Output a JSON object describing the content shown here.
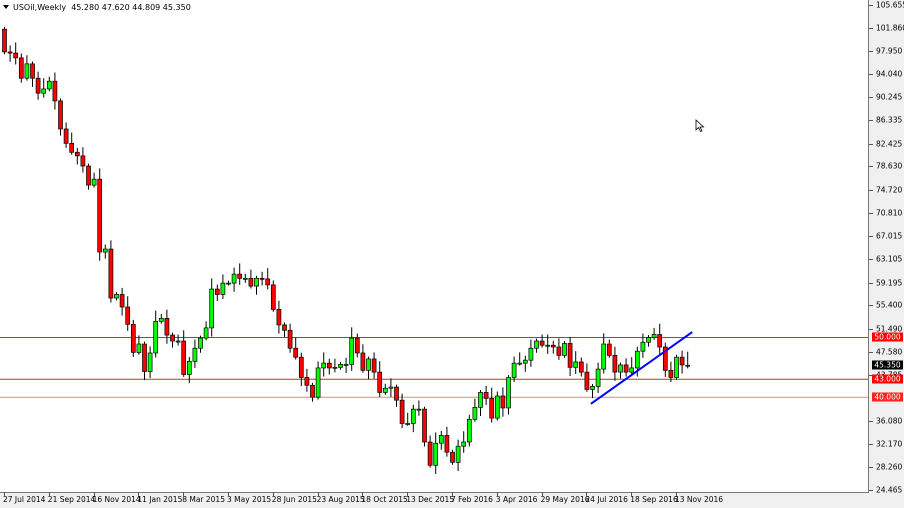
{
  "header": {
    "symbol": "USOil,Weekly",
    "ohlc": "45.280 47.620 44.809 45.350"
  },
  "colors": {
    "bull": "#00ff00",
    "bear": "#ff0000",
    "level_dark": "#b03a2e",
    "level_light": "#f08080",
    "trendline": "#0000ff",
    "current": "#000000"
  },
  "price_axis": {
    "min": 24.465,
    "max": 105.655,
    "ticks": [
      "105.655",
      "101.860",
      "97.950",
      "94.040",
      "90.245",
      "86.335",
      "82.425",
      "78.630",
      "74.720",
      "70.810",
      "67.015",
      "63.105",
      "59.195",
      "55.400",
      "51.490",
      "47.580",
      "43.785",
      "36.080",
      "32.170",
      "28.260",
      "24.465"
    ]
  },
  "levels": [
    {
      "value": 50.0,
      "label": "50.000",
      "style": "dark"
    },
    {
      "value": 43.0,
      "label": "43.000",
      "style": "dark"
    },
    {
      "value": 40.0,
      "label": "40.000",
      "style": "light"
    }
  ],
  "current_price": {
    "value": 45.35,
    "label": "45.350"
  },
  "time_axis": {
    "labels": [
      {
        "text": "27 Jul 2014",
        "week": 0
      },
      {
        "text": "21 Sep 2014",
        "week": 8
      },
      {
        "text": "16 Nov 2014",
        "week": 16
      },
      {
        "text": "11 Jan 2015",
        "week": 24
      },
      {
        "text": "8 Mar 2015",
        "week": 32
      },
      {
        "text": "3 May 2015",
        "week": 40
      },
      {
        "text": "28 Jun 2015",
        "week": 48
      },
      {
        "text": "23 Aug 2015",
        "week": 56
      },
      {
        "text": "18 Oct 2015",
        "week": 64
      },
      {
        "text": "13 Dec 2015",
        "week": 72
      },
      {
        "text": "7 Feb 2016",
        "week": 80
      },
      {
        "text": "3 Apr 2016",
        "week": 88
      },
      {
        "text": "29 May 2016",
        "week": 96
      },
      {
        "text": "24 Jul 2016",
        "week": 104
      },
      {
        "text": "18 Sep 2016",
        "week": 112
      },
      {
        "text": "13 Nov 2016",
        "week": 120
      }
    ]
  },
  "trendline": {
    "from": {
      "week": 104.8,
      "price": 38.9
    },
    "to": {
      "week": 122.9,
      "price": 50.9
    }
  },
  "chart_data": {
    "type": "candlestick",
    "first_open": 101.6,
    "closes": [
      97.8,
      97.6,
      96.8,
      93.4,
      95.8,
      93.4,
      90.9,
      91.6,
      92.9,
      89.6,
      84.9,
      82.5,
      81.0,
      80.4,
      78.7,
      75.5,
      76.5,
      64.3,
      64.8,
      56.6,
      57.2,
      55.1,
      52.2,
      47.5,
      48.9,
      44.3,
      47.4,
      52.7,
      53.2,
      50.4,
      49.4,
      49.4,
      43.8,
      46.0,
      48.2,
      49.9,
      51.6,
      58.1,
      57.2,
      59.1,
      59.1,
      60.6,
      59.9,
      59.9,
      58.6,
      59.9,
      59.8,
      58.8,
      54.7,
      52.1,
      51.2,
      48.2,
      46.7,
      43.3,
      42.0,
      40.0,
      44.9,
      45.7,
      44.9,
      45.0,
      45.5,
      45.5,
      49.9,
      47.4,
      44.5,
      46.4,
      44.2,
      40.8,
      41.5,
      41.7,
      39.5,
      35.6,
      35.6,
      38.0,
      38.0,
      32.5,
      28.6,
      32.3,
      33.6,
      30.8,
      29.1,
      31.8,
      32.5,
      36.3,
      38.3,
      40.8,
      39.8,
      36.5,
      40.2,
      38.2,
      43.3,
      45.7,
      45.7,
      46.2,
      48.2,
      49.4,
      48.7,
      48.7,
      48.4,
      47.0,
      49.0,
      45.0,
      45.9,
      44.2,
      41.3,
      41.8,
      44.7,
      48.9,
      47.0,
      44.2,
      45.4,
      44.2,
      44.9,
      47.7,
      49.2,
      50.0,
      50.5,
      48.4,
      44.5,
      43.3,
      46.7,
      45.4,
      45.35
    ],
    "last_candle": {
      "open": 45.28,
      "high": 47.62,
      "low": 44.809,
      "close": 45.35
    }
  }
}
